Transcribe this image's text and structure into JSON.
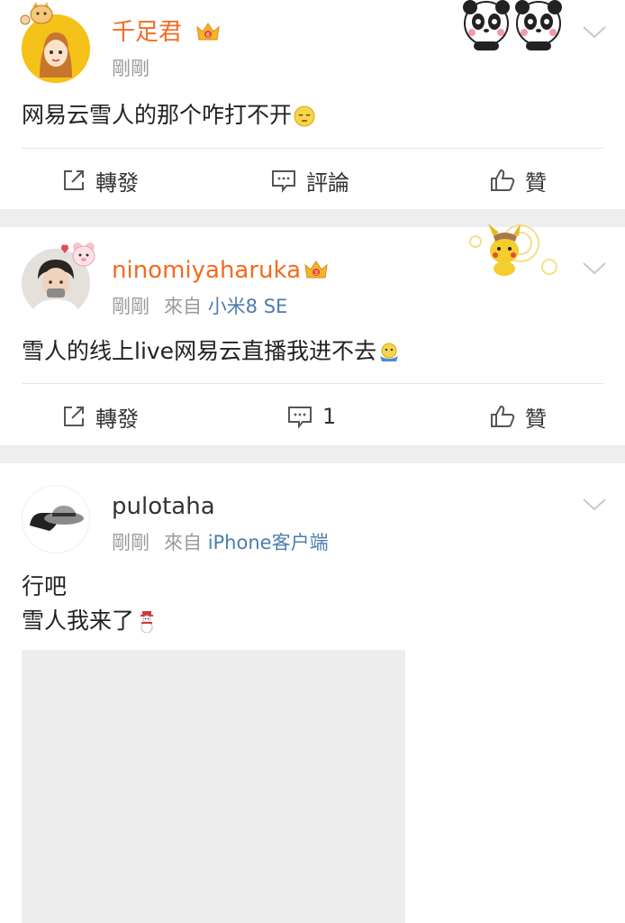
{
  "posts": [
    {
      "username": "千足君",
      "time": "剛剛",
      "text": "网易云雪人的那个咋打不开",
      "actions": {
        "forward": "轉發",
        "comment": "評論",
        "like": "贊"
      }
    },
    {
      "username": "ninomiyaharuka",
      "time": "剛剛",
      "source_prefix": "來自",
      "source": "小米8 SE",
      "text": "雪人的线上live网易云直播我进不去",
      "actions": {
        "forward": "轉發",
        "comment": "1",
        "like": "贊"
      }
    },
    {
      "username": "pulotaha",
      "time": "剛剛",
      "source_prefix": "來自",
      "source": "iPhone客户端",
      "text_line1": "行吧",
      "text_line2": "雪人我来了"
    }
  ],
  "colors": {
    "vip_name": "#f36b21",
    "source_link": "#4d7cae",
    "meta_gray": "#9a9a9a",
    "separator": "#eeeeee"
  },
  "icons": [
    "crown-badge-icon",
    "chevron-down-icon",
    "forward-icon",
    "comment-icon",
    "like-icon",
    "panda-decoration",
    "pikachu-decoration",
    "sleepy-emoji",
    "shrug-emoji",
    "snowman-emoji"
  ]
}
